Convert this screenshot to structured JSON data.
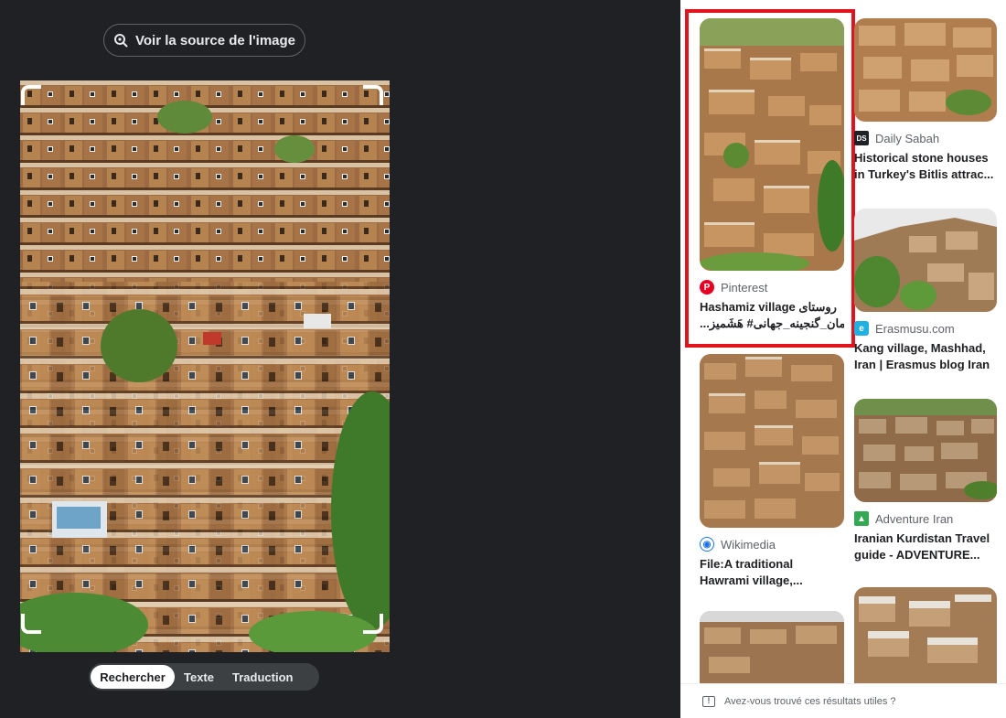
{
  "source_button": {
    "label": "Voir la source de l'image",
    "icon": "lens-search-icon"
  },
  "mode_tabs": [
    {
      "label": "Rechercher",
      "active": true
    },
    {
      "label": "Texte",
      "active": false
    },
    {
      "label": "Traduction",
      "active": false
    }
  ],
  "results": [
    {
      "source": "Pinterest",
      "title_line1": "Hashamiz village روستای",
      "title_line2": "...هورامان_گنجینه_جهانی# هَشَمیز",
      "icon_color": "#e60023",
      "highlighted": true
    },
    {
      "source": "Daily Sabah",
      "title_line1": "Historical stone houses",
      "title_line2": "in Turkey's Bitlis attrac...",
      "icon_color": "#202124"
    },
    {
      "source": "Erasmusu.com",
      "title_line1": "Kang village, Mashhad,",
      "title_line2": "Iran | Erasmus blog Iran",
      "icon_color": "#21b0e0"
    },
    {
      "source": "Wikimedia",
      "title_line1": "File:A traditional",
      "title_line2": "Hawrami village,...",
      "icon_color": "#1a73e8"
    },
    {
      "source": "Adventure Iran",
      "title_line1": "Iranian Kurdistan Travel",
      "title_line2": "guide - ADVENTURE...",
      "icon_color": "#34a853"
    }
  ],
  "feedback": {
    "text": "Avez-vous trouvé ces résultats utiles ?"
  }
}
